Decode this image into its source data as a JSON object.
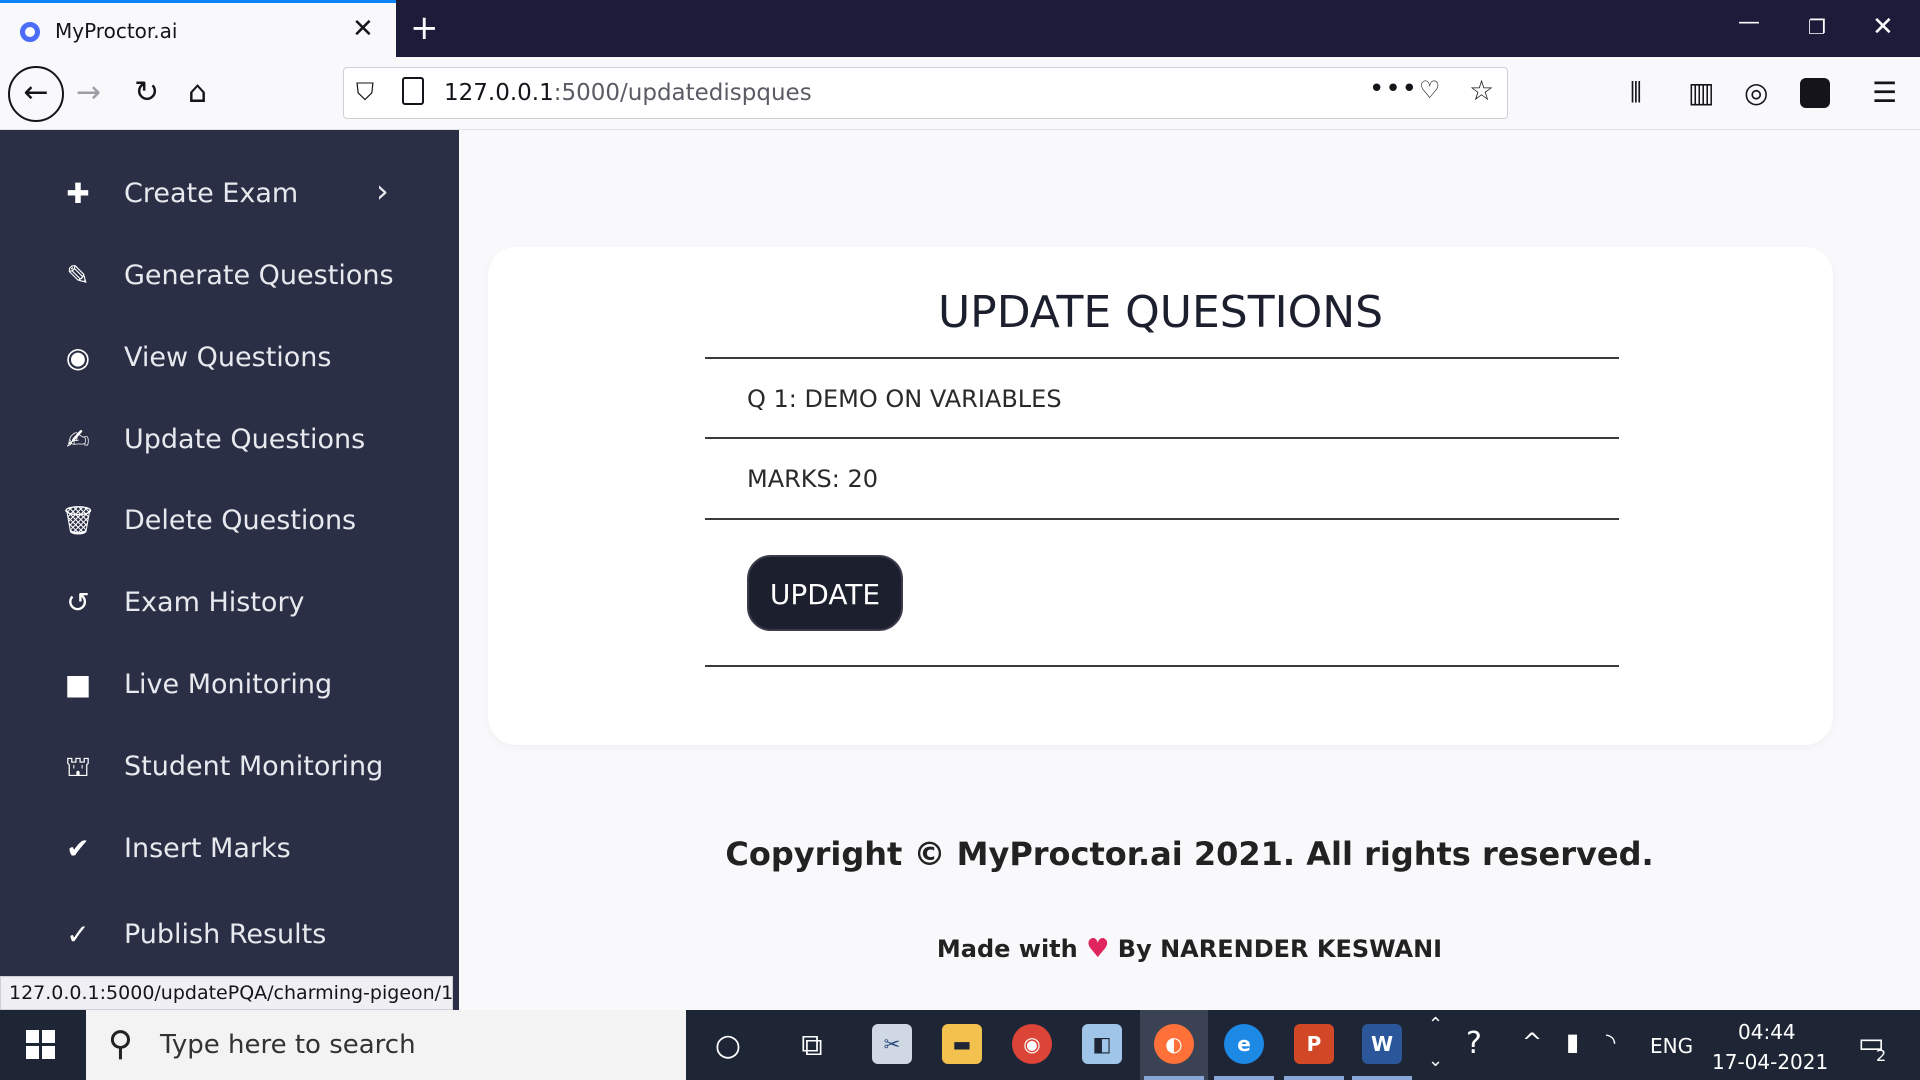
{
  "browser": {
    "tab_title": "MyProctor.ai",
    "tab_close": "✕",
    "new_tab": "+",
    "url_host": "127.0.0.1",
    "url_path": ":5000/updatedispques",
    "status_url": "127.0.0.1:5000/updatePQA/charming-pigeon/1"
  },
  "sidebar": {
    "items": [
      {
        "label": "Create Exam",
        "icon": "✚"
      },
      {
        "label": "Generate Questions",
        "icon": "✎"
      },
      {
        "label": "View Questions",
        "icon": "◉"
      },
      {
        "label": "Update Questions",
        "icon": "✍"
      },
      {
        "label": "Delete Questions",
        "icon": "🗑"
      },
      {
        "label": "Exam History",
        "icon": "↺"
      },
      {
        "label": "Live Monitoring",
        "icon": "■"
      },
      {
        "label": "Student Monitoring",
        "icon": "⛫"
      },
      {
        "label": "Insert Marks",
        "icon": "✔"
      },
      {
        "label": "Publish Results",
        "icon": "✓"
      }
    ]
  },
  "main": {
    "title": "UPDATE QUESTIONS",
    "question": "Q 1: DEMO ON VARIABLES",
    "marks": "MARKS: 20",
    "update_button": "UPDATE",
    "copyright": "Copyright © MyProctor.ai 2021. All rights reserved.",
    "made_with_prefix": "Made with",
    "made_with_suffix": "By NARENDER KESWANI"
  },
  "taskbar": {
    "search_placeholder": "Type here to search",
    "language": "ENG",
    "time": "04:44",
    "date": "17-04-2021",
    "notification_count": "2"
  },
  "colors": {
    "sidebar_bg": "#2a2f45",
    "button_bg": "#1c1f2e",
    "tab_accent": "#0a84ff",
    "taskbar_bg": "#1e2636"
  }
}
